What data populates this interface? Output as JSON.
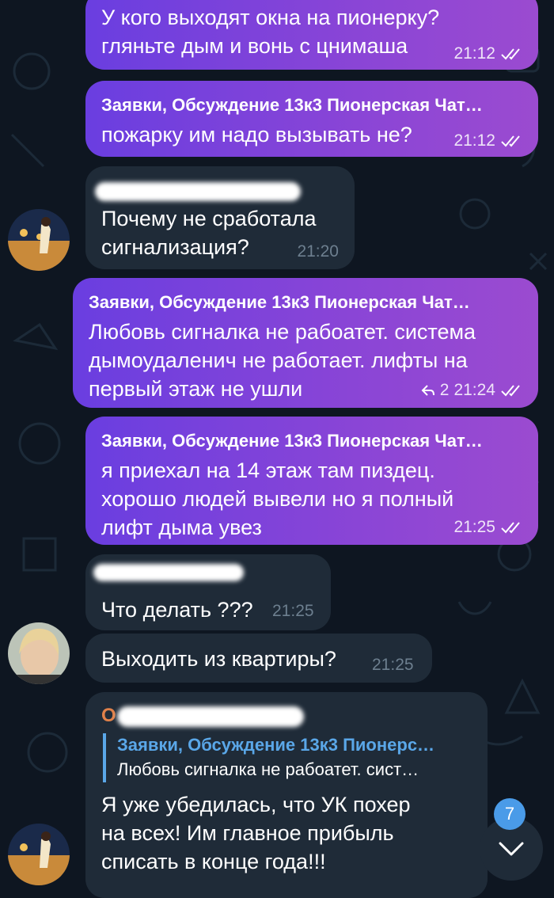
{
  "colors": {
    "background": "#0e1621",
    "outgoing_bubble": "#8a45d6",
    "incoming_bubble": "#1f2b38",
    "quote_accent": "#5aa7e8",
    "sender_orange": "#e0814a",
    "badge": "#4a9be8"
  },
  "messages": [
    {
      "direction": "out",
      "text": "У кого выходят окна на пионерку?\nгляньте дым и вонь с цнимаша",
      "time": "21:12",
      "status_icon": "double-check-icon"
    },
    {
      "direction": "out",
      "reply_title": "Заявки, Обсуждение 13к3 Пионерская Чат…",
      "text": "пожарку им надо вызывать не?",
      "time": "21:12",
      "status_icon": "double-check-icon"
    },
    {
      "direction": "in",
      "text": "Почему не сработала\nсигнализация?",
      "time": "21:20"
    },
    {
      "direction": "out",
      "reply_title": "Заявки, Обсуждение 13к3 Пионерская Чат…",
      "text": "Любовь сигналка не рабоатет. система\nдымоудаленич не работает. лифты на\nпервый этаж не ушли",
      "replies": "2",
      "time": "21:24",
      "status_icon": "double-check-icon"
    },
    {
      "direction": "out",
      "reply_title": "Заявки, Обсуждение 13к3 Пионерская Чат…",
      "text": "я приехал на 14 этаж там пиздец.\nхорошо людей вывели но я полный\nлифт дыма увез",
      "time": "21:25",
      "status_icon": "double-check-icon"
    },
    {
      "direction": "in",
      "text": "Что делать ???",
      "time": "21:25"
    },
    {
      "direction": "in",
      "text": "Выходить из квартиры?",
      "time": "21:25"
    },
    {
      "direction": "in",
      "sender_initial": "О",
      "quote_title": "Заявки, Обсуждение 13к3 Пионерс…",
      "quote_text": "Любовь сигналка не рабоатет. сист…",
      "text": "Я уже убедилась, что УК похер\nна всех! Им главное прибыль\nсписать в конце года!!!"
    }
  ],
  "scroll_down": {
    "unread_count": "7",
    "icon": "chevron-down-icon"
  }
}
